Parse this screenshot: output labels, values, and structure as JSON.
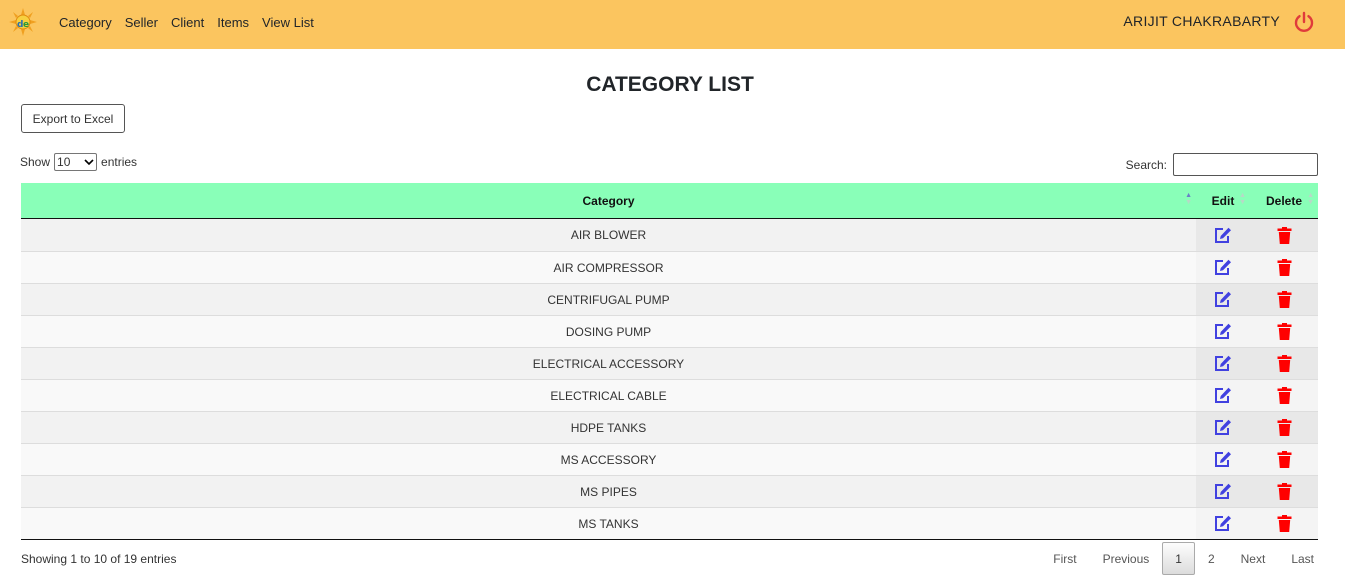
{
  "nav": {
    "links": [
      "Category",
      "Seller",
      "Client",
      "Items",
      "View List"
    ],
    "user": "ARIJIT CHAKRABARTY"
  },
  "page": {
    "title": "CATEGORY LIST",
    "export_label": "Export to Excel"
  },
  "controls": {
    "show_label": "Show",
    "entries_value": "10",
    "entries_label": "entries",
    "search_label": "Search:",
    "search_value": ""
  },
  "table": {
    "headers": [
      "Category",
      "Edit",
      "Delete"
    ],
    "rows": [
      "AIR BLOWER",
      "AIR COMPRESSOR",
      "CENTRIFUGAL PUMP",
      "DOSING PUMP",
      "ELECTRICAL ACCESSORY",
      "ELECTRICAL CABLE",
      "HDPE TANKS",
      "MS ACCESSORY",
      "MS PIPES",
      "MS TANKS"
    ]
  },
  "footer": {
    "info": "Showing 1 to 10 of 19 entries",
    "pagination": [
      "First",
      "Previous",
      "1",
      "2",
      "Next",
      "Last"
    ],
    "current_page": "1"
  },
  "colors": {
    "navbar": "#fbc55f",
    "table_header": "#89ffb8",
    "edit_icon": "#4141e0",
    "delete_icon": "#ff0000",
    "power_icon": "#e03b3b"
  },
  "icons": {
    "logo": "sun-logo-icon",
    "power": "power-icon",
    "edit": "edit-icon",
    "delete": "trash-icon"
  }
}
